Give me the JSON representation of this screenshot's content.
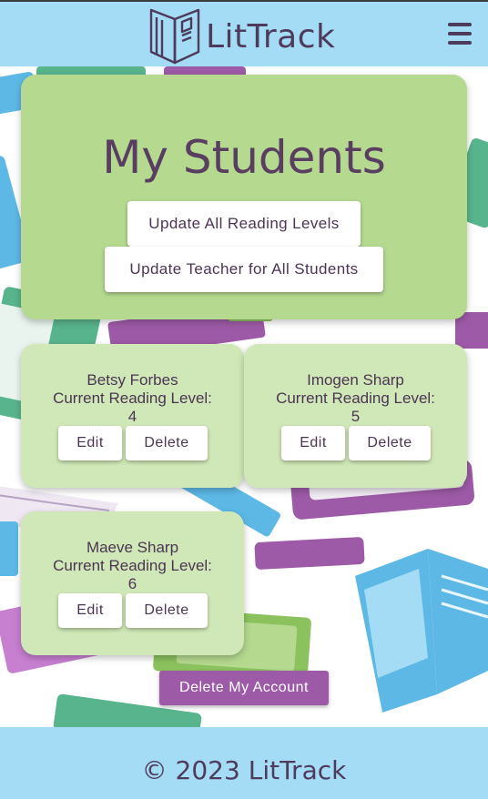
{
  "header": {
    "logo_text": "LitTrack",
    "logo_icon": "open-book-icon",
    "menu_icon": "hamburger-menu-icon"
  },
  "hero": {
    "title": "My Students",
    "update_levels_label": "Update All Reading Levels",
    "update_teacher_label": "Update Teacher for All Students"
  },
  "students": [
    {
      "name": "Betsy Forbes",
      "level_label": "Current Reading Level:",
      "level": "4",
      "edit_label": "Edit",
      "delete_label": "Delete"
    },
    {
      "name": "Imogen Sharp",
      "level_label": "Current Reading Level:",
      "level": "5",
      "edit_label": "Edit",
      "delete_label": "Delete"
    },
    {
      "name": "Maeve Sharp",
      "level_label": "Current Reading Level:",
      "level": "6",
      "edit_label": "Edit",
      "delete_label": "Delete"
    }
  ],
  "delete_account_label": "Delete My Account",
  "footer": {
    "text": "© 2023 LitTrack"
  },
  "colors": {
    "header_bg": "#a3dcf4",
    "hero_bg": "#b4d98f",
    "card_bg": "#d0e8b7",
    "text": "#4b3553",
    "accent_purple": "#9d5aa6"
  }
}
